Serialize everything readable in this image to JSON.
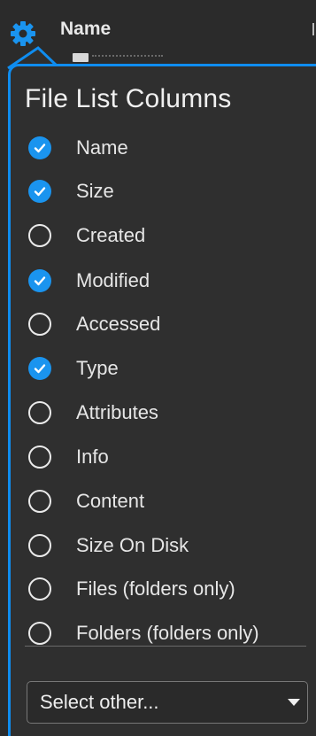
{
  "header": {
    "column_label": "Name",
    "settings_icon": "gear-icon",
    "accent": "#1a94ef"
  },
  "popup": {
    "title": "File List Columns",
    "columns": [
      {
        "label": "Name",
        "checked": true
      },
      {
        "label": "Size",
        "checked": true
      },
      {
        "label": "Created",
        "checked": false
      },
      {
        "label": "Modified",
        "checked": true
      },
      {
        "label": "Accessed",
        "checked": false
      },
      {
        "label": "Type",
        "checked": true
      },
      {
        "label": "Attributes",
        "checked": false
      },
      {
        "label": "Info",
        "checked": false
      },
      {
        "label": "Content",
        "checked": false
      },
      {
        "label": "Size On Disk",
        "checked": false
      },
      {
        "label": "Files (folders only)",
        "checked": false
      },
      {
        "label": "Folders (folders only)",
        "checked": false
      }
    ],
    "select_other": {
      "label": "Select other...",
      "icon": "dropdown-caret-icon"
    }
  }
}
